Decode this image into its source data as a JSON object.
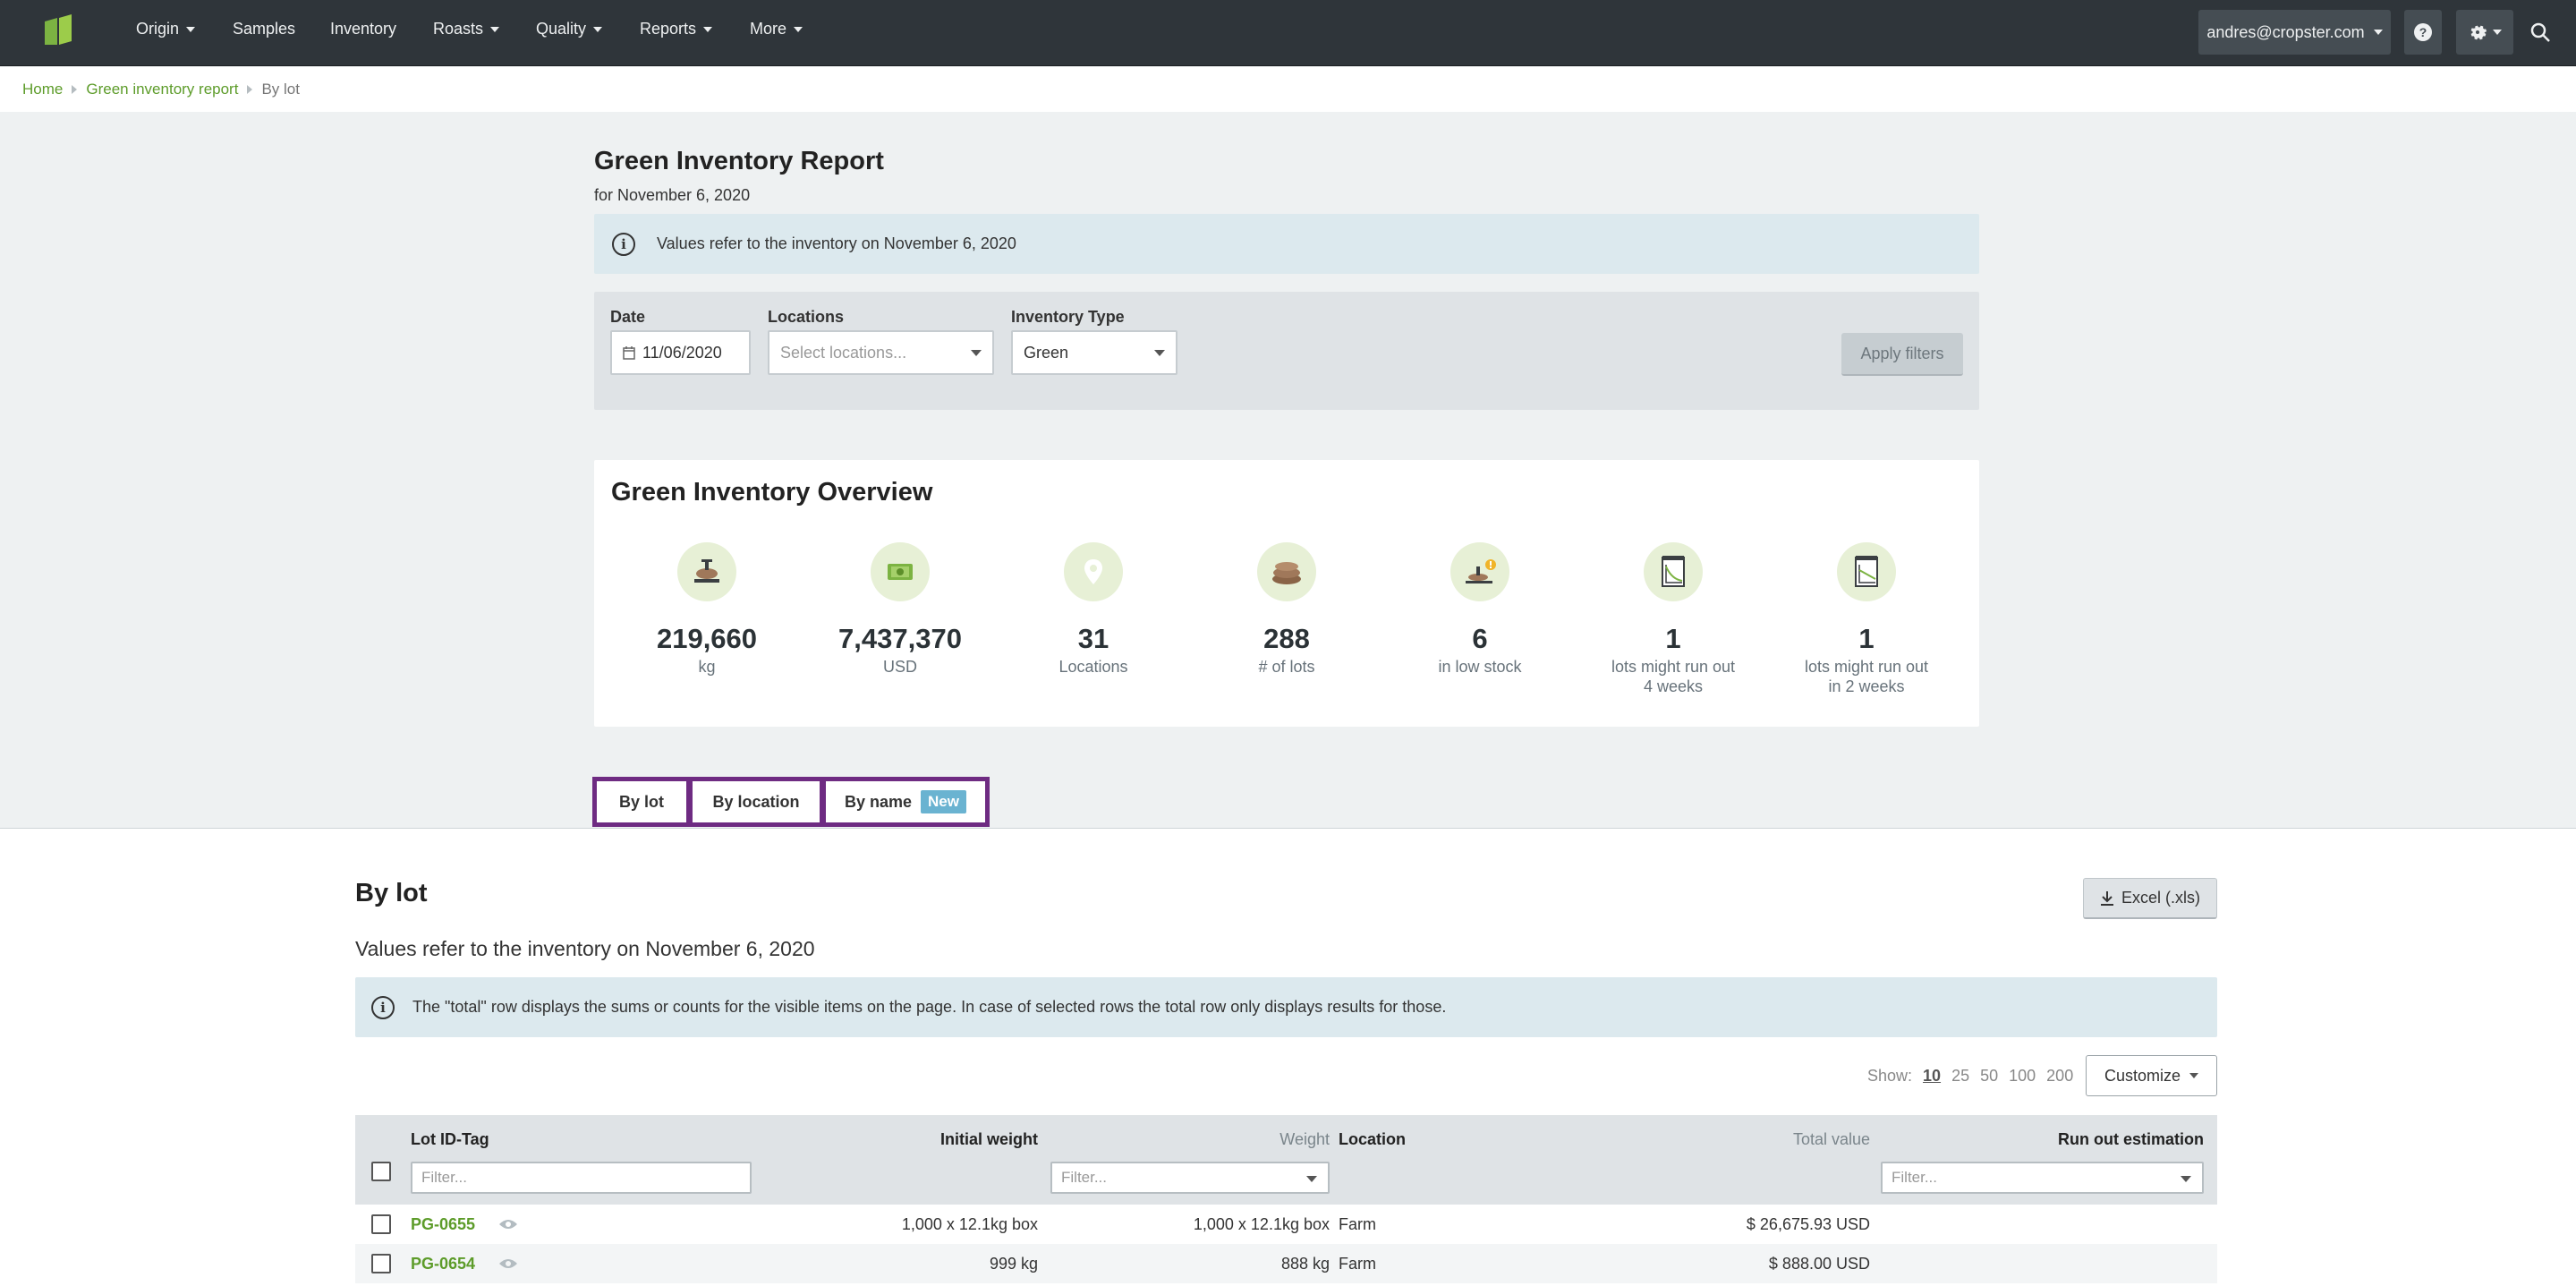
{
  "nav": {
    "items": [
      {
        "label": "Origin",
        "has_caret": true
      },
      {
        "label": "Samples",
        "has_caret": false
      },
      {
        "label": "Inventory",
        "has_caret": false
      },
      {
        "label": "Roasts",
        "has_caret": true
      },
      {
        "label": "Quality",
        "has_caret": true
      },
      {
        "label": "Reports",
        "has_caret": true
      },
      {
        "label": "More",
        "has_caret": true
      }
    ],
    "user": "andres@cropster.com"
  },
  "breadcrumb": {
    "home": "Home",
    "report": "Green inventory report",
    "current": "By lot"
  },
  "header": {
    "title": "Green Inventory Report",
    "subtitle": "for November 6, 2020",
    "info": "Values refer to the inventory on November 6, 2020"
  },
  "filters": {
    "date_label": "Date",
    "date_value": "11/06/2020",
    "locations_label": "Locations",
    "locations_placeholder": "Select locations...",
    "type_label": "Inventory Type",
    "type_value": "Green",
    "apply": "Apply filters"
  },
  "overview": {
    "title": "Green Inventory Overview",
    "stats": [
      {
        "icon": "scale-icon",
        "value": "219,660",
        "label": "kg",
        "label2": ""
      },
      {
        "icon": "money-icon",
        "value": "7,437,370",
        "label": "USD",
        "label2": ""
      },
      {
        "icon": "location-pin-icon",
        "value": "31",
        "label": "Locations",
        "label2": ""
      },
      {
        "icon": "coffee-bags-icon",
        "value": "288",
        "label": "# of lots",
        "label2": ""
      },
      {
        "icon": "low-stock-scale-icon",
        "value": "6",
        "label": "in low stock",
        "label2": ""
      },
      {
        "icon": "calendar-chart-icon",
        "value": "1",
        "label": "lots might run out",
        "label2": "4 weeks"
      },
      {
        "icon": "calendar-chart-icon",
        "value": "1",
        "label": "lots might run out",
        "label2": "in 2 weeks"
      }
    ]
  },
  "tabs": {
    "by_lot": "By lot",
    "by_location": "By location",
    "by_name": "By name",
    "new_badge": "New"
  },
  "section": {
    "title": "By lot",
    "subtitle": "Values refer to the inventory on November 6, 2020",
    "excel": "Excel (.xls)",
    "info": "The \"total\" row displays the sums or counts for the visible items on the page. In case of selected rows the total row only displays results for those.",
    "show_label": "Show:",
    "page_sizes": [
      "10",
      "25",
      "50",
      "100",
      "200"
    ],
    "customize": "Customize"
  },
  "table": {
    "columns": {
      "lot": "Lot ID-Tag",
      "initial_weight": "Initial weight",
      "weight": "Weight",
      "location": "Location",
      "total_value": "Total value",
      "run_out": "Run out estimation"
    },
    "filter_placeholder": "Filter...",
    "rows": [
      {
        "lot": "PG-0655",
        "initial_weight": "1,000 x 12.1kg box",
        "weight": "1,000 x 12.1kg box",
        "location": "Farm",
        "total_value": "$ 26,675.93 USD",
        "run_out": ""
      },
      {
        "lot": "PG-0654",
        "initial_weight": "999 kg",
        "weight": "888 kg",
        "location": "Farm",
        "total_value": "$ 888.00 USD",
        "run_out": ""
      }
    ]
  },
  "colors": {
    "navbar": "#2f353a",
    "accent_green": "#5d9c2a",
    "tab_highlight": "#6e2b82",
    "info_bg": "#dce9ee",
    "badge_blue": "#6ab3d1"
  }
}
